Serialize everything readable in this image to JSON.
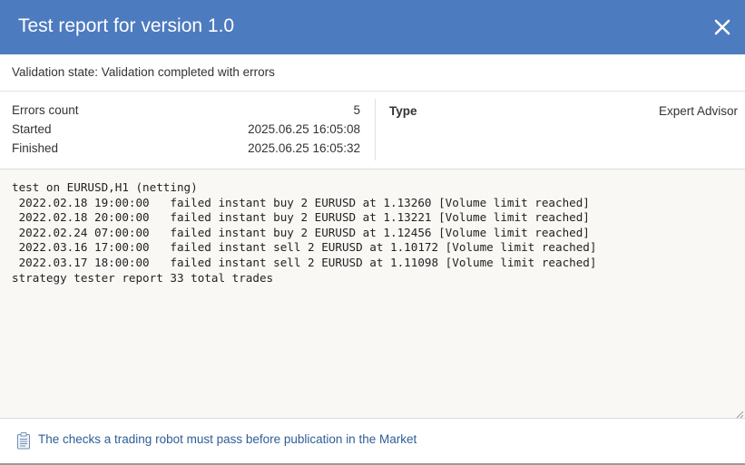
{
  "dialog": {
    "title": "Test report for version 1.0",
    "close_icon": "close-icon"
  },
  "validation": {
    "state_text": "Validation state: Validation completed with errors"
  },
  "summary": {
    "errors_label": "Errors count",
    "errors_value": "5",
    "started_label": "Started",
    "started_value": "2025.06.25 16:05:08",
    "finished_label": "Finished",
    "finished_value": "2025.06.25 16:05:32",
    "type_label": "Type",
    "type_value": "Expert Advisor"
  },
  "log": {
    "header": "test on EURUSD,H1 (netting)",
    "entries": [
      " 2022.02.18 19:00:00   failed instant buy 2 EURUSD at 1.13260 [Volume limit reached]",
      " 2022.02.18 20:00:00   failed instant buy 2 EURUSD at 1.13221 [Volume limit reached]",
      " 2022.02.24 07:00:00   failed instant buy 2 EURUSD at 1.12456 [Volume limit reached]",
      " 2022.03.16 17:00:00   failed instant sell 2 EURUSD at 1.10172 [Volume limit reached]",
      " 2022.03.17 18:00:00   failed instant sell 2 EURUSD at 1.11098 [Volume limit reached]"
    ],
    "footer": "strategy tester report 33 total trades"
  },
  "footer": {
    "icon": "clipboard-icon",
    "link_text": "The checks a trading robot must pass before publication in the Market"
  },
  "colors": {
    "titlebar": "#4d7bbf",
    "link": "#2d5e97",
    "log_background": "#f9f8f5"
  }
}
